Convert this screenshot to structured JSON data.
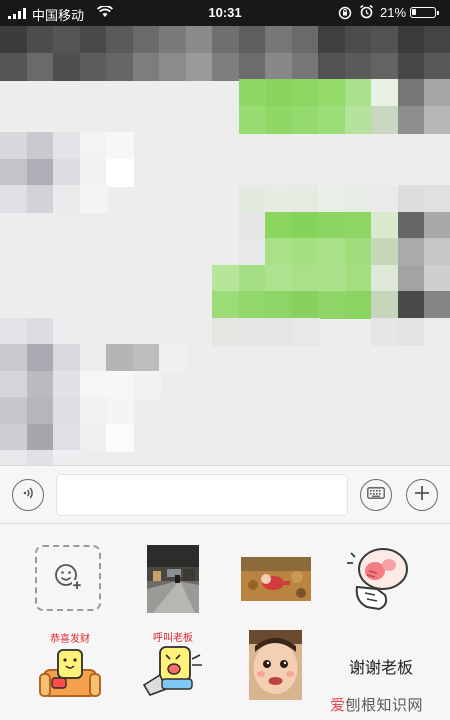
{
  "status_bar": {
    "carrier": "中国移动",
    "time": "10:31",
    "battery_text": "21%",
    "battery_level": 0.21,
    "signal_icon": "signal-bars-icon",
    "wifi_icon": "wifi-icon",
    "lock_icon": "rotation-lock-icon",
    "alarm_icon": "alarm-clock-icon"
  },
  "chat": {
    "message_area": "pixelated-mosaic",
    "bubble_color": "#95ec69"
  },
  "input_bar": {
    "voice_icon": "voice-icon",
    "message_value": "",
    "keyboard_icon": "keyboard-icon",
    "plus_icon": "plus-icon"
  },
  "stickers": {
    "add_icon": "add-sticker-smiley-icon",
    "items": [
      {
        "kind": "photo-street-scene"
      },
      {
        "kind": "photo-baby-on-leaves"
      },
      {
        "kind": "peach-cartoon-hand"
      },
      {
        "kind": "cartoon-sofa-fortune"
      },
      {
        "kind": "cartoon-megaphone"
      },
      {
        "kind": "photo-baby-face"
      },
      {
        "kind": "text-sticker",
        "label": "谢谢老板"
      }
    ],
    "sticker_1_caption": "恭喜发财",
    "sticker_2_caption": "呼叫老板"
  },
  "watermark": {
    "accent": "爱",
    "rest": "刨根知识网"
  }
}
